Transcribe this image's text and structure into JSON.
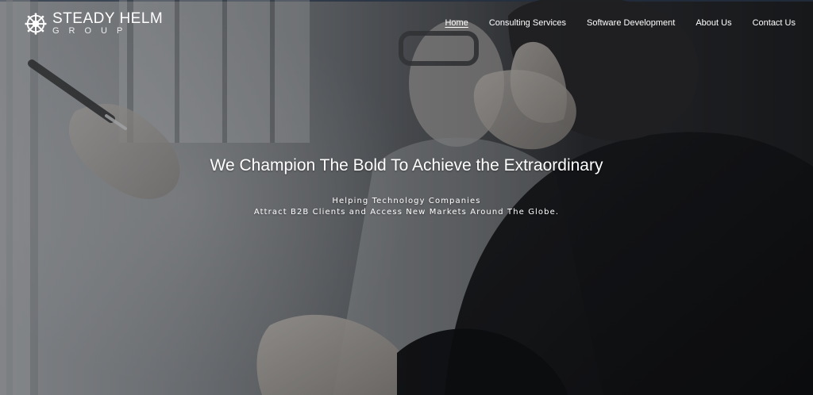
{
  "brand": {
    "line1": "STEADY HELM",
    "line2": "GROUP",
    "logo_icon": "ship-wheel-icon"
  },
  "nav": {
    "items": [
      {
        "label": "Home",
        "active": true
      },
      {
        "label": "Consulting Services",
        "active": false
      },
      {
        "label": "Software Development",
        "active": false
      },
      {
        "label": "About Us",
        "active": false
      },
      {
        "label": "Contact Us",
        "active": false
      }
    ]
  },
  "hero": {
    "headline": "We Champion The Bold To Achieve the Extraordinary",
    "subline_1": "Helping Technology Companies",
    "subline_2": "Attract B2B Clients and Access New Markets Around The Globe."
  },
  "colors": {
    "text": "#ffffff",
    "top_border": "#2f4058"
  }
}
